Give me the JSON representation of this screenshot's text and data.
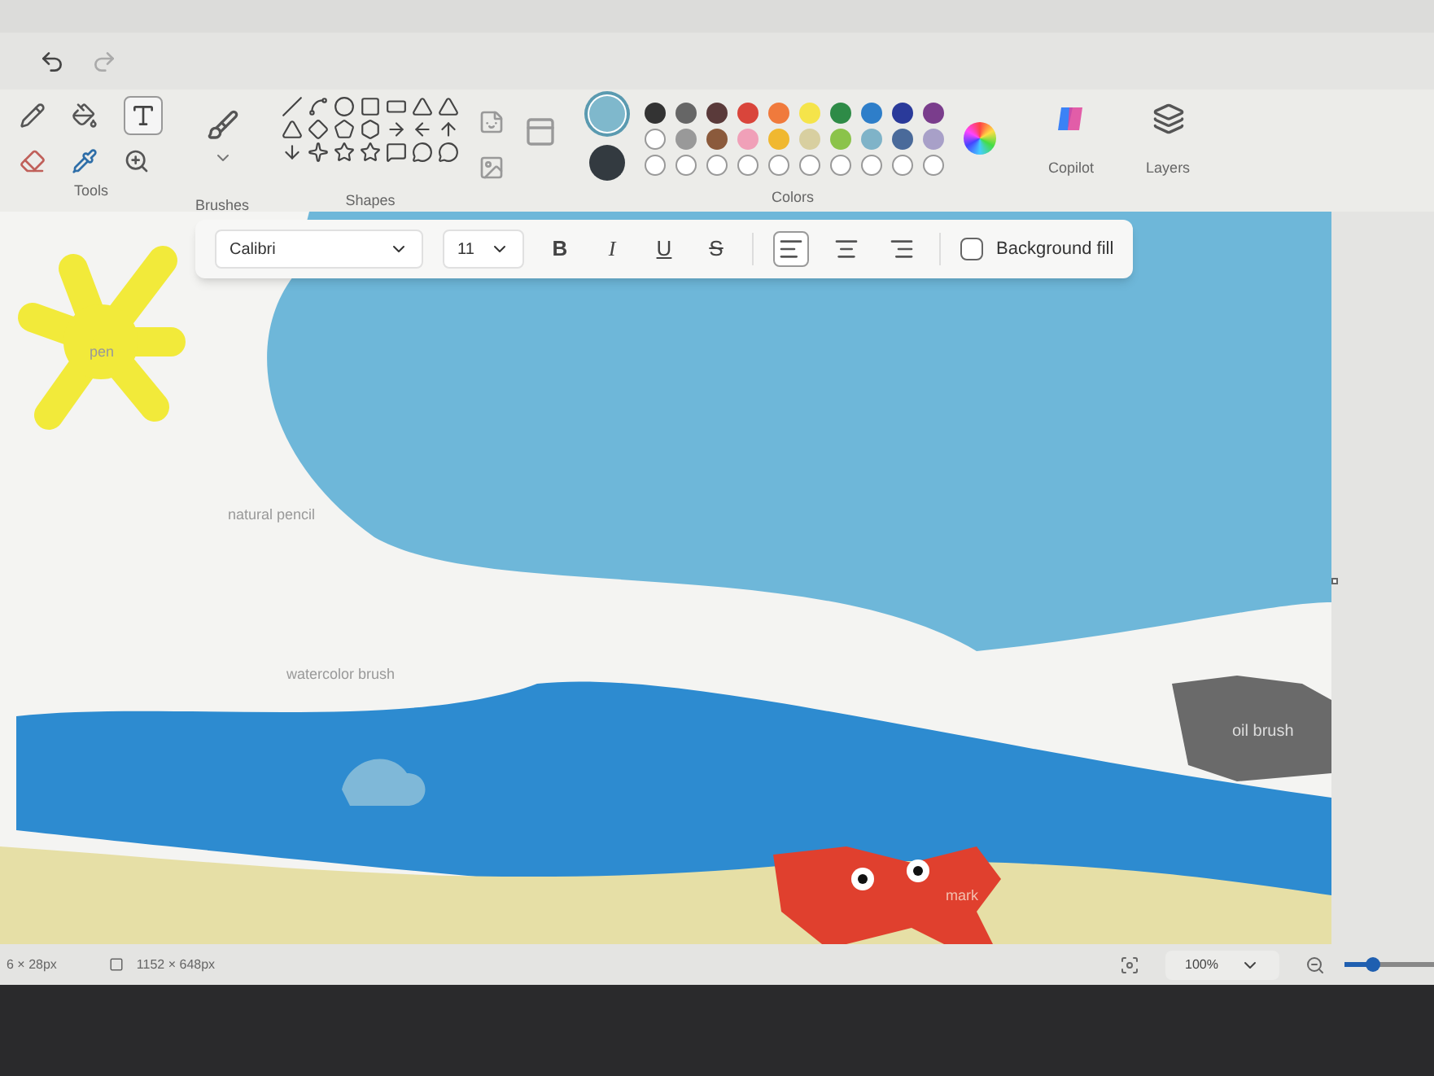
{
  "ribbon": {
    "groups": [
      {
        "label": "Tools"
      },
      {
        "label": "Brushes"
      },
      {
        "label": "Shapes"
      },
      {
        "label": "Colors"
      },
      {
        "label": "Copilot"
      },
      {
        "label": "Layers"
      }
    ],
    "current_colors": [
      {
        "color": "#7fb8cc",
        "selected": true
      },
      {
        "color": "#333a40",
        "selected": false
      }
    ],
    "palette": [
      [
        {
          "kind": "swatch",
          "color": "#333333"
        },
        {
          "kind": "swatch",
          "color": "#666666"
        },
        {
          "kind": "swatch",
          "color": "#5a3a3a"
        },
        {
          "kind": "swatch",
          "color": "#d9453b"
        },
        {
          "kind": "swatch",
          "color": "#f07a3c"
        },
        {
          "kind": "swatch",
          "color": "#f5e44a"
        },
        {
          "kind": "swatch",
          "color": "#2e8b47"
        },
        {
          "kind": "swatch",
          "color": "#2e7ec9"
        },
        {
          "kind": "swatch",
          "color": "#2a3a9a"
        },
        {
          "kind": "swatch",
          "color": "#7a3d8c"
        }
      ],
      [
        {
          "kind": "empty"
        },
        {
          "kind": "swatch",
          "color": "#999999"
        },
        {
          "kind": "swatch",
          "color": "#8b5a3c"
        },
        {
          "kind": "swatch",
          "color": "#f0a0b8"
        },
        {
          "kind": "swatch",
          "color": "#f0b830"
        },
        {
          "kind": "swatch",
          "color": "#d8cfa0"
        },
        {
          "kind": "swatch",
          "color": "#8bc34a"
        },
        {
          "kind": "swatch",
          "color": "#7fb3c8"
        },
        {
          "kind": "swatch",
          "color": "#4a6a9a"
        },
        {
          "kind": "swatch",
          "color": "#a8a0c8"
        }
      ],
      [
        {
          "kind": "empty"
        },
        {
          "kind": "empty"
        },
        {
          "kind": "empty"
        },
        {
          "kind": "empty"
        },
        {
          "kind": "empty"
        },
        {
          "kind": "empty"
        },
        {
          "kind": "empty"
        },
        {
          "kind": "empty"
        },
        {
          "kind": "empty"
        },
        {
          "kind": "empty"
        }
      ]
    ]
  },
  "text_toolbar": {
    "font": "Calibri",
    "size": "11",
    "styles": [
      {
        "label": "B",
        "kind": "bold"
      },
      {
        "label": "I",
        "kind": "italic"
      },
      {
        "label": "U",
        "kind": "underline"
      },
      {
        "label": "S",
        "kind": "strike"
      }
    ],
    "alignments": [
      {
        "kind": "left",
        "selected": true
      },
      {
        "kind": "center",
        "selected": false
      },
      {
        "kind": "right",
        "selected": false
      }
    ],
    "background_fill": {
      "label": "Background fill",
      "checked": false
    }
  },
  "canvas": {
    "labels": [
      {
        "text": "pen",
        "kind": "pen"
      },
      {
        "text": "natural pencil",
        "kind": "pencil"
      },
      {
        "text": "watercolor brush",
        "kind": "watercolor"
      },
      {
        "text": "oil brush",
        "kind": "oil"
      },
      {
        "text": "mark",
        "kind": "marker"
      }
    ]
  },
  "status_bar": {
    "cursor": "6 × 28px",
    "canvas_size": "1152 × 648px",
    "zoom": "100%",
    "zoom_slider": {
      "level": 0.3
    }
  }
}
